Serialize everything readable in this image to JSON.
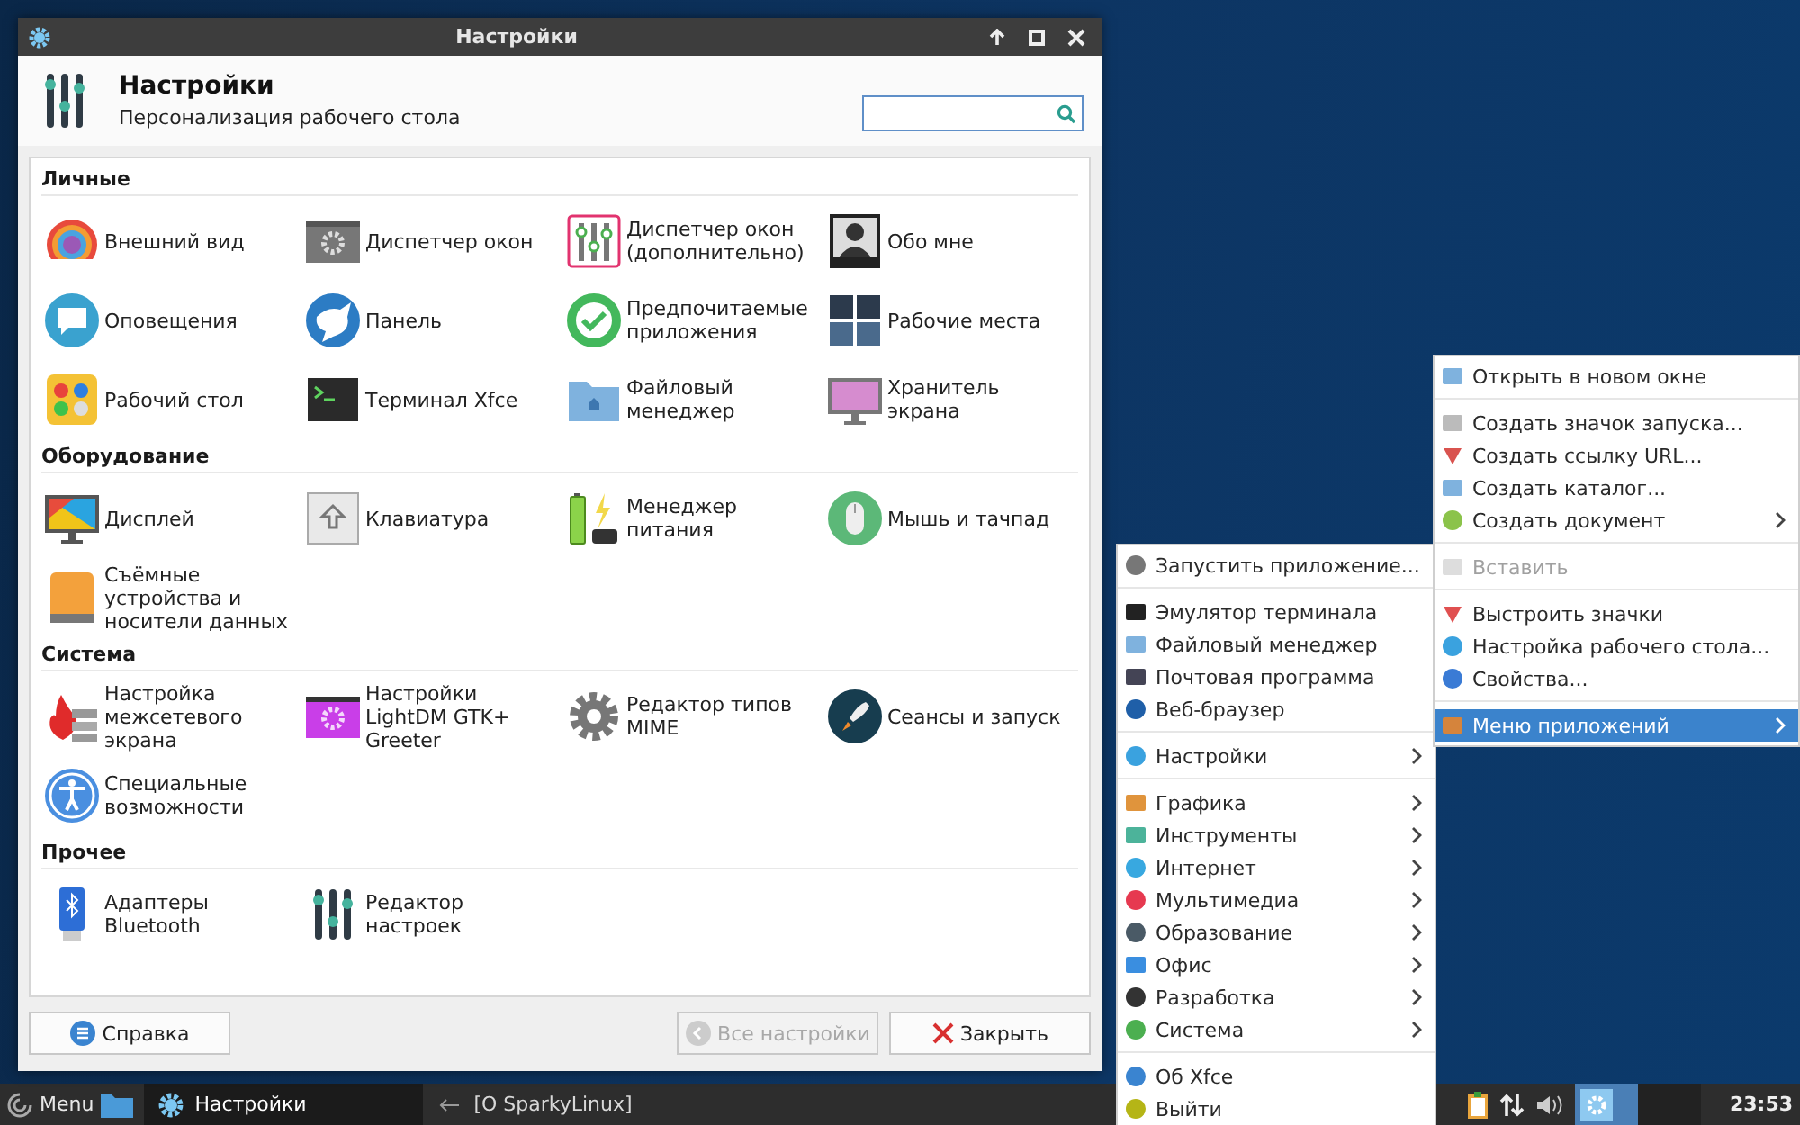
{
  "window": {
    "title": "Настройки"
  },
  "header": {
    "title": "Настройки",
    "subtitle": "Персонализация рабочего стола"
  },
  "sections": [
    {
      "title": "Личные",
      "items": [
        {
          "label": "Внешний вид"
        },
        {
          "label": "Диспетчер окон"
        },
        {
          "label": "Диспетчер окон (дополнительно)"
        },
        {
          "label": "Обо мне"
        },
        {
          "label": "Оповещения"
        },
        {
          "label": "Панель"
        },
        {
          "label": "Предпочитаемые приложения"
        },
        {
          "label": "Рабочие места"
        },
        {
          "label": "Рабочий стол"
        },
        {
          "label": "Терминал Xfce"
        },
        {
          "label": "Файловый менеджер"
        },
        {
          "label": "Хранитель экрана"
        }
      ]
    },
    {
      "title": "Оборудование",
      "items": [
        {
          "label": "Дисплей"
        },
        {
          "label": "Клавиатура"
        },
        {
          "label": "Менеджер питания"
        },
        {
          "label": "Мышь и тачпад"
        },
        {
          "label": "Съёмные устройства и носители данных"
        }
      ]
    },
    {
      "title": "Система",
      "items": [
        {
          "label": "Настройка межсетевого экрана"
        },
        {
          "label": "Настройки LightDM GTK+ Greeter"
        },
        {
          "label": "Редактор типов MIME"
        },
        {
          "label": "Сеансы и запуск"
        },
        {
          "label": "Специальные возможности"
        }
      ]
    },
    {
      "title": "Прочее",
      "items": [
        {
          "label": "Адаптеры Bluetooth"
        },
        {
          "label": "Редактор настроек"
        }
      ]
    }
  ],
  "buttons": [
    {
      "label": "Справка",
      "disabled": false
    },
    {
      "label": "Все настройки",
      "disabled": true
    },
    {
      "label": "Закрыть",
      "disabled": false
    }
  ],
  "desktop_menu": {
    "groups": [
      [
        {
          "label": "Открыть в новом окне",
          "disabled": false,
          "submenu": false,
          "selected": false
        }
      ],
      [
        {
          "label": "Создать значок запуска...",
          "disabled": false,
          "submenu": false,
          "selected": false
        },
        {
          "label": "Создать ссылку URL...",
          "disabled": false,
          "submenu": false,
          "selected": false
        },
        {
          "label": "Создать каталог...",
          "disabled": false,
          "submenu": false,
          "selected": false
        },
        {
          "label": "Создать документ",
          "disabled": false,
          "submenu": true,
          "selected": false
        }
      ],
      [
        {
          "label": "Вставить",
          "disabled": true,
          "submenu": false,
          "selected": false
        }
      ],
      [
        {
          "label": "Выстроить значки",
          "disabled": false,
          "submenu": false,
          "selected": false
        },
        {
          "label": "Настройка рабочего стола...",
          "disabled": false,
          "submenu": false,
          "selected": false
        },
        {
          "label": "Свойства...",
          "disabled": false,
          "submenu": false,
          "selected": false
        }
      ],
      [
        {
          "label": "Меню приложений",
          "disabled": false,
          "submenu": true,
          "selected": true
        }
      ]
    ]
  },
  "app_menu": {
    "groups": [
      [
        {
          "label": "Запустить приложение...",
          "disabled": false,
          "submenu": false,
          "selected": false
        }
      ],
      [
        {
          "label": "Эмулятор терминала",
          "disabled": false,
          "submenu": false,
          "selected": false
        },
        {
          "label": "Файловый менеджер",
          "disabled": false,
          "submenu": false,
          "selected": false
        },
        {
          "label": "Почтовая программа",
          "disabled": false,
          "submenu": false,
          "selected": false
        },
        {
          "label": "Веб-браузер",
          "disabled": false,
          "submenu": false,
          "selected": false
        }
      ],
      [
        {
          "label": "Настройки",
          "disabled": false,
          "submenu": true,
          "selected": false
        }
      ],
      [
        {
          "label": "Графика",
          "disabled": false,
          "submenu": true,
          "selected": false
        },
        {
          "label": "Инструменты",
          "disabled": false,
          "submenu": true,
          "selected": false
        },
        {
          "label": "Интернет",
          "disabled": false,
          "submenu": true,
          "selected": false
        },
        {
          "label": "Мультимедиа",
          "disabled": false,
          "submenu": true,
          "selected": false
        },
        {
          "label": "Образование",
          "disabled": false,
          "submenu": true,
          "selected": false
        },
        {
          "label": "Офис",
          "disabled": false,
          "submenu": true,
          "selected": false
        },
        {
          "label": "Разработка",
          "disabled": false,
          "submenu": true,
          "selected": false
        },
        {
          "label": "Система",
          "disabled": false,
          "submenu": true,
          "selected": false
        }
      ],
      [
        {
          "label": "Об Xfce",
          "disabled": false,
          "submenu": false,
          "selected": false
        },
        {
          "label": "Выйти",
          "disabled": false,
          "submenu": false,
          "selected": false
        }
      ]
    ]
  },
  "taskbar": {
    "menu_label": "Menu",
    "tasks": [
      {
        "label": "Настройки",
        "selected": true
      },
      {
        "label": "[О SparkyLinux]",
        "selected": false
      }
    ],
    "workspaces": [
      {
        "selected": true
      },
      {
        "selected": false
      }
    ],
    "clock": "23:53"
  }
}
